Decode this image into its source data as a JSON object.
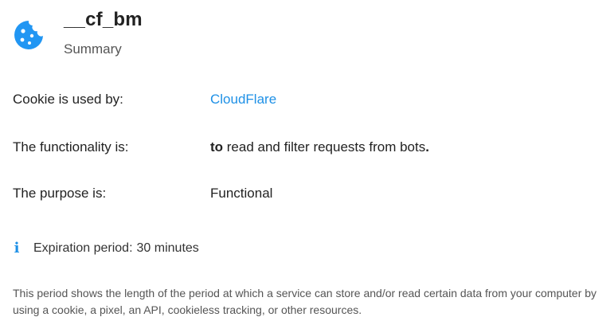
{
  "cookie": {
    "name": "__cf_bm",
    "summary_label": "Summary",
    "icon": "cookie-icon",
    "icon_color": "#2196f3"
  },
  "details": {
    "used_by": {
      "label": "Cookie is used by:",
      "value": "CloudFlare"
    },
    "functionality": {
      "label": "The functionality is:",
      "value_prefix": "to",
      "value_middle": " read and filter requests from bots",
      "value_suffix": "."
    },
    "purpose": {
      "label": "The purpose is:",
      "value": "Functional"
    }
  },
  "expiration": {
    "icon": "info-icon",
    "label": "Expiration period:",
    "value": "30 minutes"
  },
  "description": "This period shows the length of the period at which a service can store and/or read certain data from your computer by using a cookie, a pixel,  an API, cookieless tracking, or other resources.",
  "colors": {
    "accent": "#1e90e6",
    "text": "#222222",
    "muted": "#555555"
  }
}
